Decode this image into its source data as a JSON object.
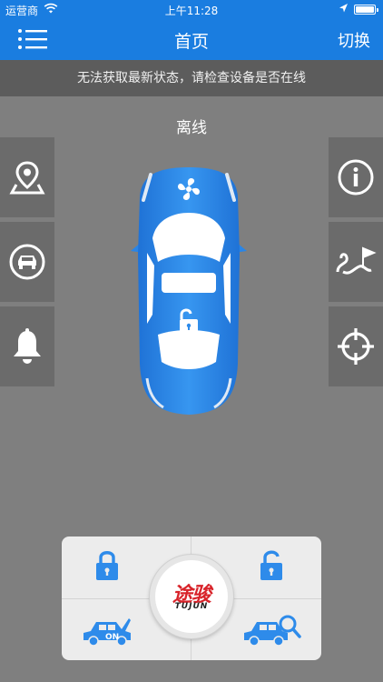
{
  "status_bar": {
    "carrier": "运营商",
    "time": "上午11:28"
  },
  "nav": {
    "title": "首页",
    "switch_label": "切换",
    "menu_icon": "list-menu-icon"
  },
  "banner": {
    "text": "无法获取最新状态，请检查设备是否在线"
  },
  "vehicle": {
    "state": "离线",
    "lock_icon": "unlocked-padlock-icon",
    "fan_icon": "fan-icon"
  },
  "left_buttons": [
    "location-pin-icon",
    "car-circle-icon",
    "bell-icon"
  ],
  "right_buttons": [
    "info-icon",
    "route-flag-icon",
    "crosshair-icon"
  ],
  "control_panel": {
    "lock_icon": "lock-icon",
    "unlock_icon": "unlock-icon",
    "engine_icon": "car-trunk-on-icon",
    "engine_label": "ON",
    "search_icon": "car-search-icon",
    "logo": {
      "cn": "途骏",
      "en": "TUJUN"
    }
  },
  "colors": {
    "accent": "#1a7de0",
    "background": "#7f7f7f",
    "car_blue": "#2e8bea",
    "logo_red": "#d8232a"
  }
}
